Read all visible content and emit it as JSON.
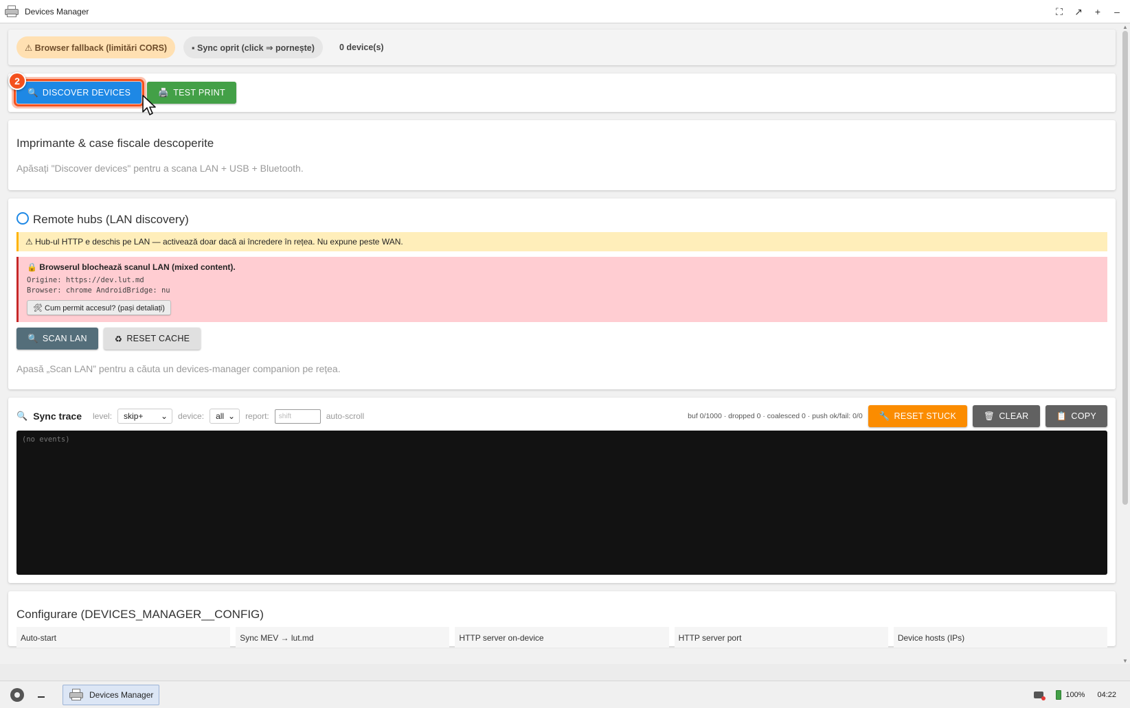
{
  "window": {
    "title": "Devices Manager",
    "controls": [
      "⛶",
      "↗",
      "+",
      "–"
    ]
  },
  "status": {
    "fallback": "⚠ Browser fallback (limitări CORS)",
    "sync": "▪ Sync oprit (click ⇒ pornește)",
    "count": "0 device(s)"
  },
  "actions": {
    "step_badge": "2",
    "discover": "DISCOVER DEVICES",
    "test_print": "TEST PRINT"
  },
  "printers": {
    "title": "Imprimante & case fiscale descoperite",
    "hint": "Apăsați \"Discover devices\" pentru a scana LAN + USB + Bluetooth."
  },
  "hubs": {
    "title": "Remote hubs (LAN discovery)",
    "warning": "⚠ Hub-ul HTTP e deschis pe LAN — activează doar dacă ai încredere în rețea. Nu expune peste WAN.",
    "error_title": "🔒 Browserul blochează scanul LAN (mixed content).",
    "origin_line": "Origine: https://dev.lut.md",
    "browser_line": "Browser: chrome AndroidBridge: nu",
    "help_button": "🛠 Cum permit accesul? (pași detaliați)",
    "scan_lan": "SCAN LAN",
    "reset_cache": "RESET CACHE",
    "hint": "Apasă „Scan LAN” pentru a căuta un devices-manager companion pe rețea."
  },
  "trace": {
    "title": "Sync trace",
    "level_label": "level:",
    "level_value": "skip+",
    "device_label": "device:",
    "device_value": "all",
    "report_label": "report:",
    "report_placeholder": "shift",
    "autoscroll_label": "auto-scroll",
    "stats": "buf 0/1000 · dropped 0 · coalesced 0 · push ok/fail: 0/0",
    "reset_stuck": "RESET STUCK",
    "clear": "CLEAR",
    "copy": "COPY",
    "console_text": "(no events)"
  },
  "config": {
    "title": "Configurare (DEVICES_MANAGER__CONFIG)",
    "fields": [
      "Auto-start",
      "Sync MEV → lut.md",
      "HTTP server on-device",
      "HTTP server port",
      "Device hosts (IPs)"
    ]
  },
  "taskbar": {
    "app_label": "Devices Manager",
    "battery": "100%",
    "time": "04:22"
  },
  "colors": {
    "primary": "#1e88e5",
    "success": "#43a047",
    "warning_bg": "#ffeeba",
    "error_bg": "#ffcdd2",
    "highlight": "#f4511e",
    "orange": "#fb8c00"
  }
}
